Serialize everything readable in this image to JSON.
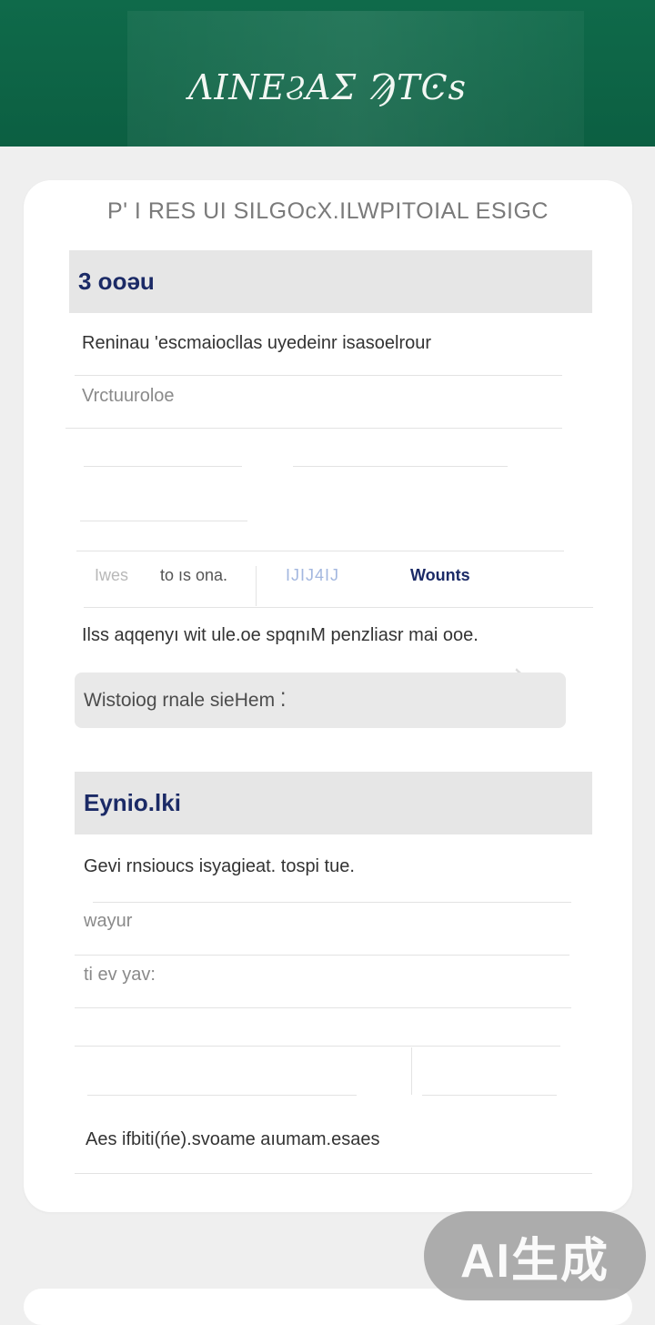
{
  "header": {
    "title": "ΛΙΝΕϨΑΣ ϠΤϾs"
  },
  "card": {
    "title": "P' I RES UI SILGOcX.ILWPITOIAL ESIGC",
    "section1": {
      "heading": "3 ooəu",
      "rows": [
        "Reninau 'escmaiocllas uyedeinr isasoelrour",
        "Vrctuuroloe"
      ],
      "tabs": [
        "Iwes",
        "to ıs ona.",
        "IJIJ4IJ",
        "Wounts"
      ],
      "description": "Ilss aqqenyı wit ule.oe spqnıM penzliasr mai ooe.",
      "note": "Wistoiog rnale sieHem ⁚"
    },
    "section2": {
      "heading": "Eynio.lki",
      "rows": [
        "Gevi rnsioucs isyagieat. tospi tue.",
        "wayur",
        "ti ev yav:"
      ],
      "footer": "Aes ifbiti(ńe).svoame aıumam.esaes"
    }
  },
  "badge": {
    "label": "AI生成"
  }
}
